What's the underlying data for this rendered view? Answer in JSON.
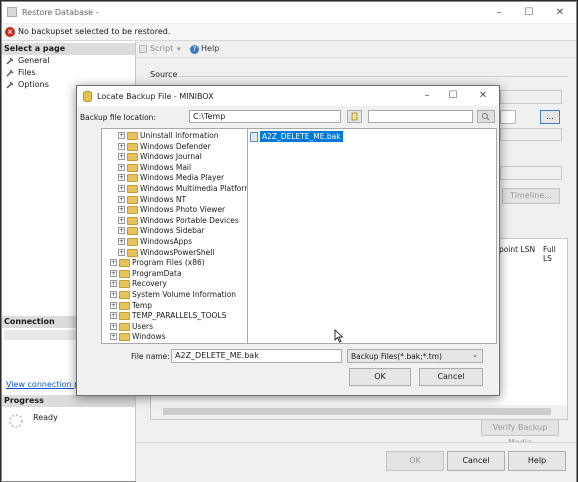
{
  "outer": {
    "title": "Restore Database -",
    "error_text": "No backupset selected to be restored.",
    "select_page_header": "Select a page",
    "pages": [
      "General",
      "Files",
      "Options"
    ],
    "toolbar": {
      "script": "Script",
      "help": "Help"
    },
    "source_label": "Source",
    "connection_header": "Connection",
    "view_connection_link": "View connection pr",
    "progress_header": "Progress",
    "progress_status": "Ready",
    "ellipsis_button": "...",
    "timeline_button": "Timeline...",
    "grid_headers": [
      "point LSN",
      "Full LS"
    ],
    "verify_button": "Verify Backup Media",
    "ok_button": "OK",
    "cancel_button": "Cancel",
    "help_button": "Help"
  },
  "dialog": {
    "title": "Locate Backup File - MINIBOX",
    "location_label": "Backup file location:",
    "location_value": "C:\\Temp",
    "tree_items": [
      {
        "label": "Uninstall Information",
        "indent": 1
      },
      {
        "label": "Windows Defender",
        "indent": 1
      },
      {
        "label": "Windows Journal",
        "indent": 1
      },
      {
        "label": "Windows Mail",
        "indent": 1
      },
      {
        "label": "Windows Media Player",
        "indent": 1
      },
      {
        "label": "Windows Multimedia Platform",
        "indent": 1
      },
      {
        "label": "Windows NT",
        "indent": 1
      },
      {
        "label": "Windows Photo Viewer",
        "indent": 1
      },
      {
        "label": "Windows Portable Devices",
        "indent": 1
      },
      {
        "label": "Windows Sidebar",
        "indent": 1
      },
      {
        "label": "WindowsApps",
        "indent": 1
      },
      {
        "label": "WindowsPowerShell",
        "indent": 1
      },
      {
        "label": "Program Files (x86)",
        "indent": 0
      },
      {
        "label": "ProgramData",
        "indent": 0
      },
      {
        "label": "Recovery",
        "indent": 0
      },
      {
        "label": "System Volume Information",
        "indent": 0
      },
      {
        "label": "Temp",
        "indent": 0
      },
      {
        "label": "TEMP_PARALLELS_TOOLS",
        "indent": 0
      },
      {
        "label": "Users",
        "indent": 0
      },
      {
        "label": "Windows",
        "indent": 0
      }
    ],
    "selected_file": "A2Z_DELETE_ME.bak",
    "file_name_label": "File name:",
    "file_name_value": "A2Z_DELETE_ME.bak",
    "file_type_value": "Backup Files(*.bak;*.tm)",
    "ok_button": "OK",
    "cancel_button": "Cancel"
  }
}
